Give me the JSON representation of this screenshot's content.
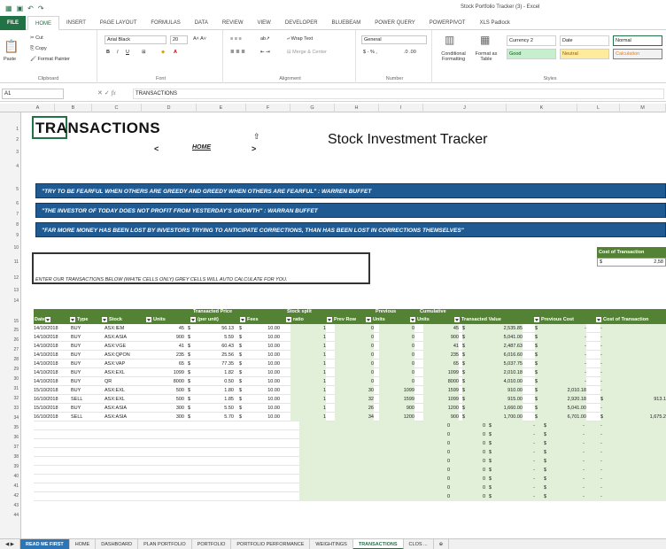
{
  "window": {
    "title": "Stock Portfolio Tracker (3) - Excel"
  },
  "ribbon": {
    "tabs": [
      "FILE",
      "HOME",
      "INSERT",
      "PAGE LAYOUT",
      "FORMULAS",
      "DATA",
      "REVIEW",
      "VIEW",
      "DEVELOPER",
      "BLUEBEAM",
      "POWER QUERY",
      "POWERPIVOT",
      "XLS Padlock"
    ],
    "clipboard": {
      "label": "Clipboard",
      "paste": "Paste",
      "cut": "Cut",
      "copy": "Copy",
      "format_painter": "Format Painter"
    },
    "font": {
      "label": "Font",
      "name": "Arial Black",
      "size": "20"
    },
    "alignment": {
      "label": "Alignment",
      "wrap": "Wrap Text",
      "merge": "Merge & Center"
    },
    "number": {
      "label": "Number",
      "format": "General"
    },
    "styles": {
      "label": "Styles",
      "conditional": "Conditional Formatting",
      "format_table": "Format as Table",
      "cells": [
        "Currency 2",
        "Date",
        "Normal",
        "Good",
        "Neutral",
        "Calculation"
      ]
    }
  },
  "formula_bar": {
    "name_box": "A1",
    "fx": "fx",
    "content": "TRANSACTIONS"
  },
  "columns": [
    "A",
    "B",
    "C",
    "D",
    "E",
    "F",
    "G",
    "H",
    "I",
    "J",
    "K",
    "L",
    "M"
  ],
  "rows": [
    "1",
    "2",
    "3",
    "4",
    "5",
    "6",
    "7",
    "8",
    "9",
    "10",
    "11",
    "12",
    "13",
    "14",
    "15",
    "25",
    "26",
    "27",
    "28",
    "29",
    "30",
    "31",
    "32",
    "33",
    "34",
    "35",
    "36",
    "37",
    "38",
    "39",
    "40",
    "41",
    "42",
    "43",
    "44"
  ],
  "sheet": {
    "title": "TRANSACTIONS",
    "subtitle": "Stock Investment Tracker",
    "nav_prev": "<",
    "nav_home": "HOME",
    "nav_next": ">",
    "nav_up": "⇧",
    "quotes": [
      "\"TRY TO BE FEARFUL WHEN OTHERS ARE GREEDY AND GREEDY WHEN OTHERS ARE FEARFUL\" : WARREN BUFFET",
      "\"THE INVESTOR OF TODAY DOES NOT PROFIT FROM YESTERDAY'S GROWTH\" : WARRAN BUFFET",
      "\"FAR MORE MONEY HAS BEEN LOST BY INVESTORS TRYING TO ANTICIPATE CORRECTIONS, THAN HAS BEEN LOST IN CORRECTIONS THEMSELVES\""
    ],
    "instructions": "ENTER OUR TRANSACTIONS BELOW (WHITE CELLS ONLY) GREY CELLS WILL AUTO CALCULATE FOR YOU.",
    "cost_box": {
      "label": "Cost of Transaction",
      "currency": "$",
      "value": "2,58"
    },
    "group_headers": {
      "price": "Transacted Price",
      "split": "Stock split",
      "previous": "Previous",
      "cumulative": "Cumulative"
    },
    "headers": [
      "Date",
      "Type",
      "Stock",
      "Units",
      "(per unit)",
      "Fees",
      "ratio",
      "Prev Row",
      "Units",
      "Units",
      "Transacted Value",
      "Previous Cost",
      "Cost of Transaction"
    ],
    "data_rows": [
      [
        "14/10/2018",
        "BUY",
        "ASX:IEM",
        "45",
        "$",
        "56.13",
        "$",
        "10.00",
        "1",
        "0",
        "0",
        "45",
        "$",
        "2,535.85",
        "$",
        "-",
        "-",
        ""
      ],
      [
        "14/10/2018",
        "BUY",
        "ASX:ASIA",
        "900",
        "$",
        "5.59",
        "$",
        "10.00",
        "1",
        "0",
        "0",
        "900",
        "$",
        "5,041.00",
        "$",
        "-",
        "-",
        ""
      ],
      [
        "14/10/2018",
        "BUY",
        "ASX:VGE",
        "41",
        "$",
        "60.43",
        "$",
        "10.00",
        "1",
        "0",
        "0",
        "41",
        "$",
        "2,487.63",
        "$",
        "-",
        "-",
        ""
      ],
      [
        "14/10/2018",
        "BUY",
        "ASX:QPON",
        "235",
        "$",
        "25.56",
        "$",
        "10.00",
        "1",
        "0",
        "0",
        "235",
        "$",
        "6,016.60",
        "$",
        "-",
        "-",
        ""
      ],
      [
        "14/10/2018",
        "BUY",
        "ASX:VAP",
        "65",
        "$",
        "77.35",
        "$",
        "10.00",
        "1",
        "0",
        "0",
        "65",
        "$",
        "5,037.75",
        "$",
        "-",
        "-",
        ""
      ],
      [
        "14/10/2018",
        "BUY",
        "ASX:EXL",
        "1099",
        "$",
        "1.82",
        "$",
        "10.00",
        "1",
        "0",
        "0",
        "1099",
        "$",
        "2,010.18",
        "$",
        "-",
        "-",
        ""
      ],
      [
        "14/10/2018",
        "BUY",
        "QR",
        "8000",
        "$",
        "0.50",
        "$",
        "10.00",
        "1",
        "0",
        "0",
        "8000",
        "$",
        "4,010.00",
        "$",
        "-",
        "-",
        ""
      ],
      [
        "15/10/2018",
        "BUY",
        "ASX:EXL",
        "500",
        "$",
        "1.80",
        "$",
        "10.00",
        "1",
        "30",
        "1099",
        "1599",
        "$",
        "910.00",
        "$",
        "2,010.18",
        "-",
        ""
      ],
      [
        "16/10/2018",
        "SELL",
        "ASX:EXL",
        "500",
        "$",
        "1.85",
        "$",
        "10.00",
        "1",
        "32",
        "1599",
        "1099",
        "$",
        "915.00",
        "$",
        "2,920.18",
        "$",
        "913.1"
      ],
      [
        "15/10/2018",
        "BUY",
        "ASX:ASIA",
        "300",
        "$",
        "5.50",
        "$",
        "10.00",
        "1",
        "26",
        "900",
        "1200",
        "$",
        "1,660.00",
        "$",
        "5,041.00",
        "-",
        ""
      ],
      [
        "16/10/2018",
        "SELL",
        "ASX:ASIA",
        "300",
        "$",
        "5.70",
        "$",
        "10.00",
        "1",
        "34",
        "1200",
        "900",
        "$",
        "1,700.00",
        "$",
        "6,701.00",
        "$",
        "1,675.2"
      ]
    ],
    "empty_rows": [
      [
        "0",
        "0",
        "$",
        "-",
        "$",
        "-",
        "-"
      ],
      [
        "0",
        "0",
        "$",
        "-",
        "$",
        "-",
        "-"
      ],
      [
        "0",
        "0",
        "$",
        "-",
        "$",
        "-",
        "-"
      ],
      [
        "0",
        "0",
        "$",
        "-",
        "$",
        "-",
        "-"
      ],
      [
        "0",
        "0",
        "$",
        "-",
        "$",
        "-",
        "-"
      ],
      [
        "0",
        "0",
        "$",
        "-",
        "$",
        "-",
        "-"
      ],
      [
        "0",
        "0",
        "$",
        "-",
        "$",
        "-",
        "-"
      ],
      [
        "0",
        "0",
        "$",
        "-",
        "$",
        "-",
        "-"
      ],
      [
        "0",
        "0",
        "$",
        "-",
        "$",
        "-",
        "-"
      ]
    ]
  },
  "sheet_tabs": [
    "READ ME FIRST",
    "HOME",
    "DASHBOARD",
    "PLAN PORTFOLIO",
    "PORTFOLIO",
    "PORTFOLIO PERFORMANCE",
    "WEIGHTINGS",
    "TRANSACTIONS",
    "CLOS ..."
  ],
  "sheet_tabs_active": "TRANSACTIONS",
  "colors": {
    "excel_green": "#217346",
    "header_green": "#548235",
    "quote_blue": "#1f5a92",
    "calc_grey": "#e2efd9"
  }
}
